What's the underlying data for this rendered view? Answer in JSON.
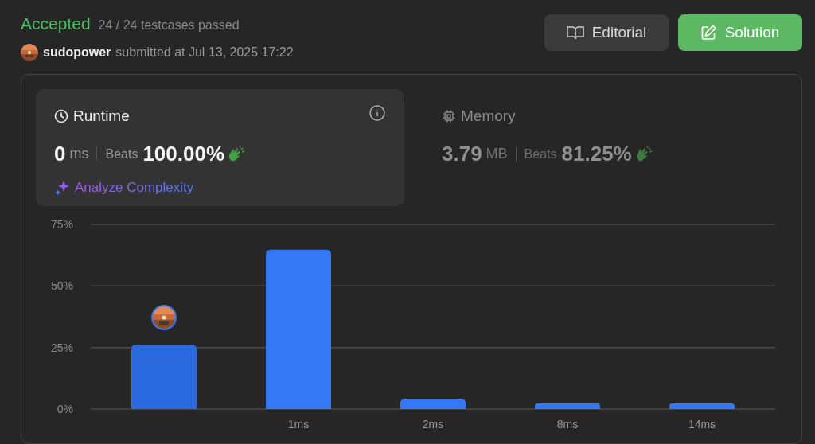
{
  "header": {
    "status": "Accepted",
    "testcases": "24 / 24 testcases passed",
    "user": "sudopower",
    "submitted": "submitted at Jul 13, 2025 17:22"
  },
  "buttons": [
    {
      "label": "Editorial",
      "kind": "editorial"
    },
    {
      "label": "Solution",
      "kind": "solution"
    }
  ],
  "metrics": [
    {
      "kind": "runtime",
      "title": "Runtime",
      "selected": true,
      "value": "0",
      "unit": "ms",
      "beats_label": "Beats",
      "beats": "100.00%",
      "link": "Analyze Complexity"
    },
    {
      "kind": "memory",
      "title": "Memory",
      "selected": false,
      "value": "3.79",
      "unit": "MB",
      "beats_label": "Beats",
      "beats": "81.25%"
    }
  ],
  "chart": {
    "bar_selected": [
      true,
      false,
      false,
      false,
      false
    ],
    "chart_data": {
      "type": "bar",
      "categories": [
        null,
        "1ms",
        "2ms",
        "8ms",
        "14ms"
      ],
      "values": [
        26.2,
        64.7,
        4.2,
        2.3,
        2.3
      ],
      "ylim": [
        0,
        75
      ],
      "yticks": [
        {
          "value": 0,
          "label": "0%"
        },
        {
          "value": 25,
          "label": "25%"
        },
        {
          "value": 50,
          "label": "50%"
        },
        {
          "value": 75,
          "label": "75%"
        }
      ]
    }
  }
}
